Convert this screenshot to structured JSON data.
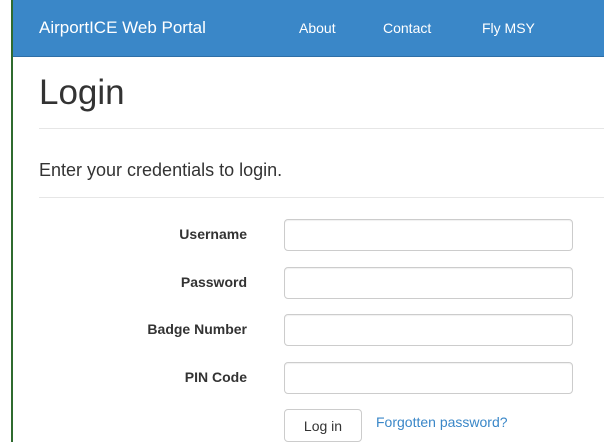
{
  "navbar": {
    "brand": "AirportICE Web Portal",
    "links": [
      {
        "label": "About"
      },
      {
        "label": "Contact"
      },
      {
        "label": "Fly MSY"
      }
    ]
  },
  "colors": {
    "navbar_bg": "#3a87c8",
    "link": "#3a87c8",
    "text": "#333333",
    "left_rule": "#2f6b2f"
  },
  "page": {
    "title": "Login",
    "subtitle": "Enter your credentials to login."
  },
  "form": {
    "fields": [
      {
        "label": "Username",
        "value": "",
        "placeholder": ""
      },
      {
        "label": "Password",
        "value": "",
        "placeholder": ""
      },
      {
        "label": "Badge Number",
        "value": "",
        "placeholder": ""
      },
      {
        "label": "PIN Code",
        "value": "",
        "placeholder": ""
      }
    ],
    "submit_label": "Log in",
    "forgot_label": "Forgotten password?"
  }
}
